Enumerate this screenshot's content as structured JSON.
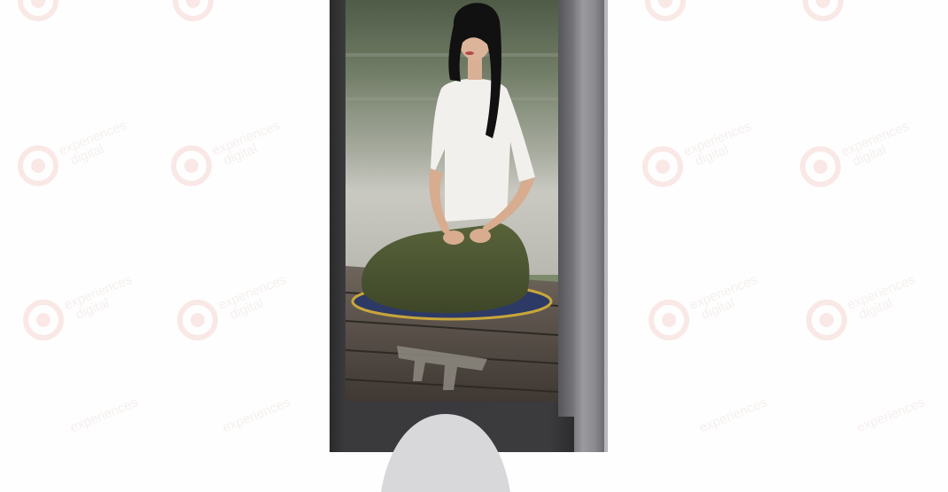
{
  "watermark": {
    "line1": "experiences",
    "line2": "digital",
    "logo_name": "experiences-digital-logo",
    "color": "#e8c5bd"
  },
  "kiosk": {
    "frame_color": "#3a3a3d",
    "side_color": "#8e8e92",
    "screen_content": "woman-meditating-on-wooden-dock"
  }
}
